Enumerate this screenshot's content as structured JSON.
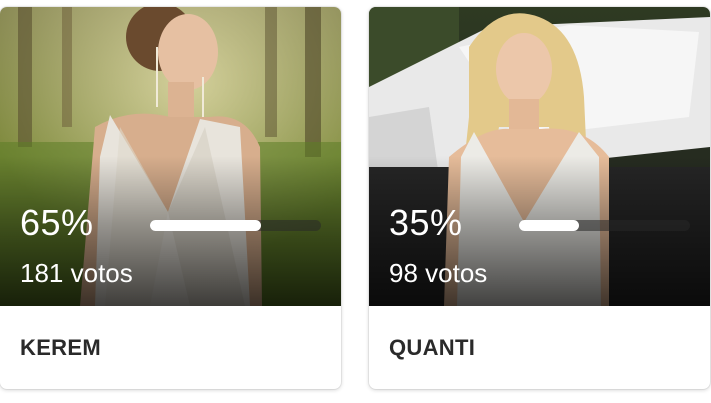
{
  "options": [
    {
      "name": "KEREM",
      "percent_label": "65%",
      "percent": 65,
      "votes_label": "181 votos"
    },
    {
      "name": "QUANTI",
      "percent_label": "35%",
      "percent": 35,
      "votes_label": "98 votos"
    }
  ],
  "colors": {
    "bar_fill": "#ffffff",
    "bar_track": "#3a3a3a",
    "label_text": "#2a2a2a",
    "card_bg": "#ffffff"
  }
}
